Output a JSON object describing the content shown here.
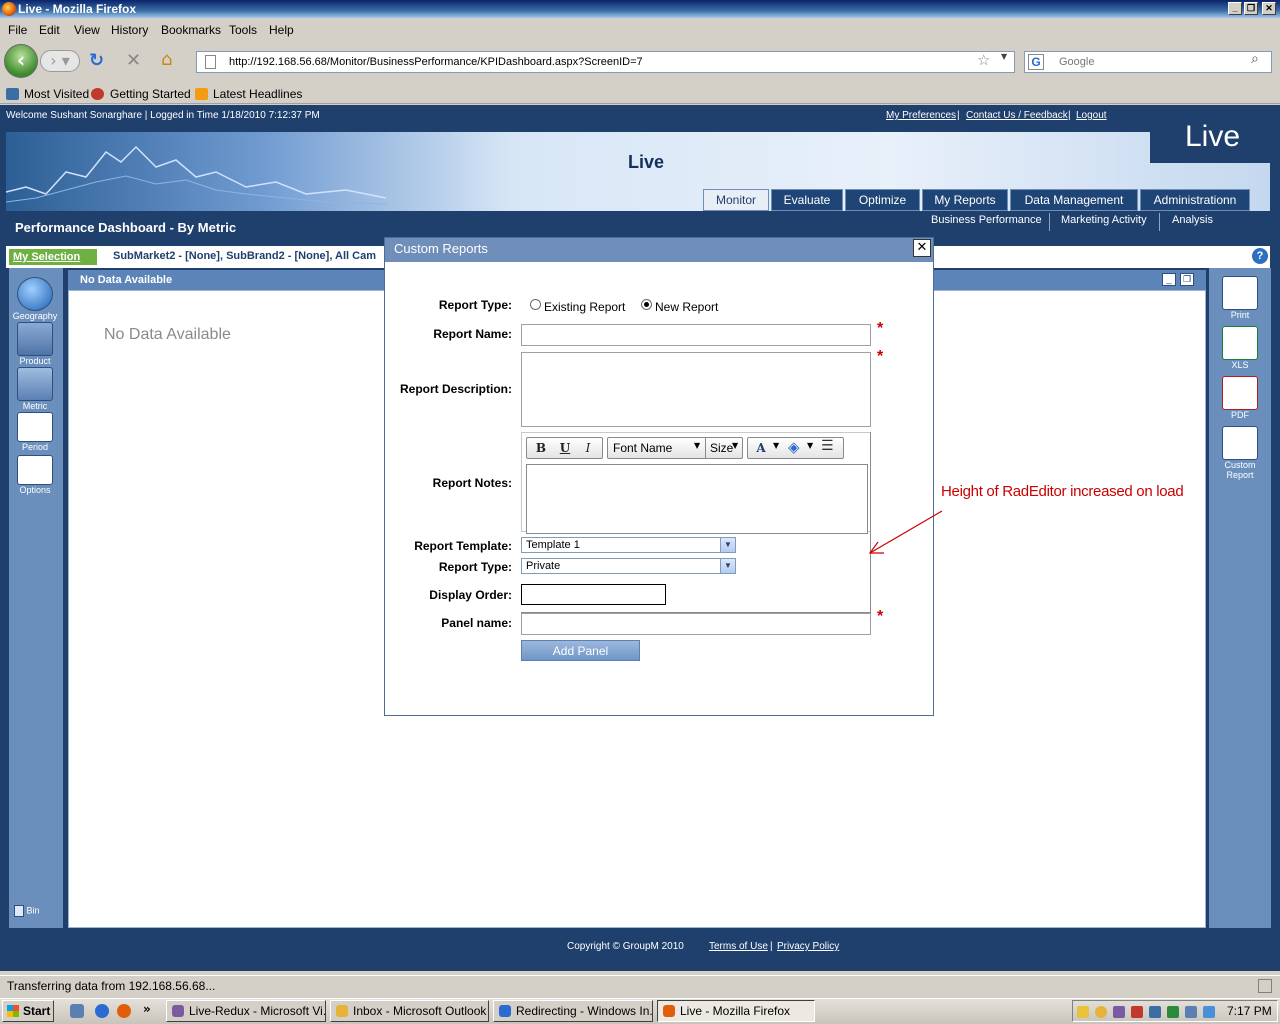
{
  "window": {
    "title": "Live - Mozilla Firefox"
  },
  "menu": [
    "File",
    "Edit",
    "View",
    "History",
    "Bookmarks",
    "Tools",
    "Help"
  ],
  "nav": {
    "url": "http://192.168.56.68/Monitor/BusinessPerformance/KPIDashboard.aspx?ScreenID=7",
    "search_placeholder": "Google"
  },
  "bookmarks": [
    "Most Visited",
    "Getting Started",
    "Latest Headlines"
  ],
  "page": {
    "welcome": "Welcome Sushant Sonarghare | Logged in Time 1/18/2010 7:12:37 PM",
    "top_links": [
      "My Preferences",
      "Contact Us / Feedback",
      "Logout"
    ],
    "logo": "Live",
    "banner_title": "Live",
    "tabs": [
      "Monitor",
      "Evaluate",
      "Optimize",
      "My Reports",
      "Data Management",
      "Administrationn"
    ],
    "subtabs": [
      "Business Performance",
      "Marketing Activity",
      "Analysis"
    ],
    "title": "Performance Dashboard - By Metric",
    "my_selection": "My Selection",
    "selection_text": "SubMarket2 - [None], SubBrand2 - [None], All Cam",
    "left_rail": [
      "Geography",
      "Product",
      "Metric",
      "Period",
      "Options"
    ],
    "bin": "Bin",
    "right_rail": [
      "Print",
      "XLS",
      "PDF",
      "Custom Report"
    ],
    "panel_title": "No Data Available",
    "no_data": "No Data Available",
    "footer": {
      "copyright": "Copyright © GroupM 2010",
      "terms": "Terms of Use",
      "privacy": "Privacy Policy"
    }
  },
  "modal": {
    "title": "Custom Reports",
    "close": "✕",
    "labels": {
      "report_type": "Report Type:",
      "report_name": "Report Name:",
      "report_description": "Report Description:",
      "report_notes": "Report Notes:",
      "report_template": "Report Template:",
      "report_type2": "Report Type:",
      "display_order": "Display Order:",
      "panel_name": "Panel name:"
    },
    "radio": {
      "existing": "Existing Report",
      "new": "New Report",
      "selected": "New Report"
    },
    "required_mark": "*",
    "editor": {
      "bold": "B",
      "underline": "U",
      "italic": "I",
      "font_name": "Font Name",
      "size": "Size",
      "font_color": "A"
    },
    "report_template_value": "Template 1",
    "report_type_value": "Private",
    "display_order_value": "",
    "panel_name_value": "",
    "add_panel": "Add Panel"
  },
  "annotation": "Height of RadEditor increased on load",
  "status": "Transferring data from 192.168.56.68...",
  "taskbar": {
    "start": "Start",
    "tasks": [
      "Live-Redux - Microsoft Vi...",
      "Inbox - Microsoft Outlook",
      "Redirecting - Windows In...",
      "Live - Mozilla Firefox"
    ],
    "clock": "7:17 PM"
  },
  "colors": {
    "accent": "#1f3f6d",
    "selection_green": "#6fb042",
    "annotation_red": "#cc0000"
  }
}
